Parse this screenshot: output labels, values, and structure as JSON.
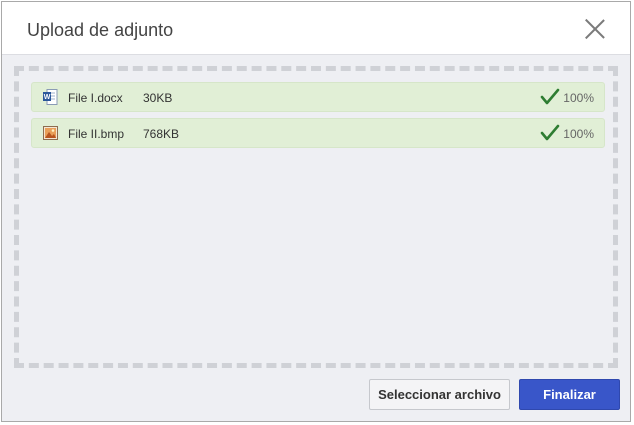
{
  "dialog": {
    "title": "Upload de adjunto",
    "close_icon": "close-icon"
  },
  "files": [
    {
      "name": "File I.docx",
      "size": "30KB",
      "progress": "100%",
      "icon": "word-file-icon",
      "status_icon": "check-icon"
    },
    {
      "name": "File II.bmp",
      "size": "768KB",
      "progress": "100%",
      "icon": "image-file-icon",
      "status_icon": "check-icon"
    }
  ],
  "buttons": {
    "select_label": "Seleccionar archivo",
    "finish_label": "Finalizar"
  },
  "colors": {
    "primary": "#3956c9",
    "success_bg": "#e1efd6",
    "check": "#2e7d32"
  }
}
